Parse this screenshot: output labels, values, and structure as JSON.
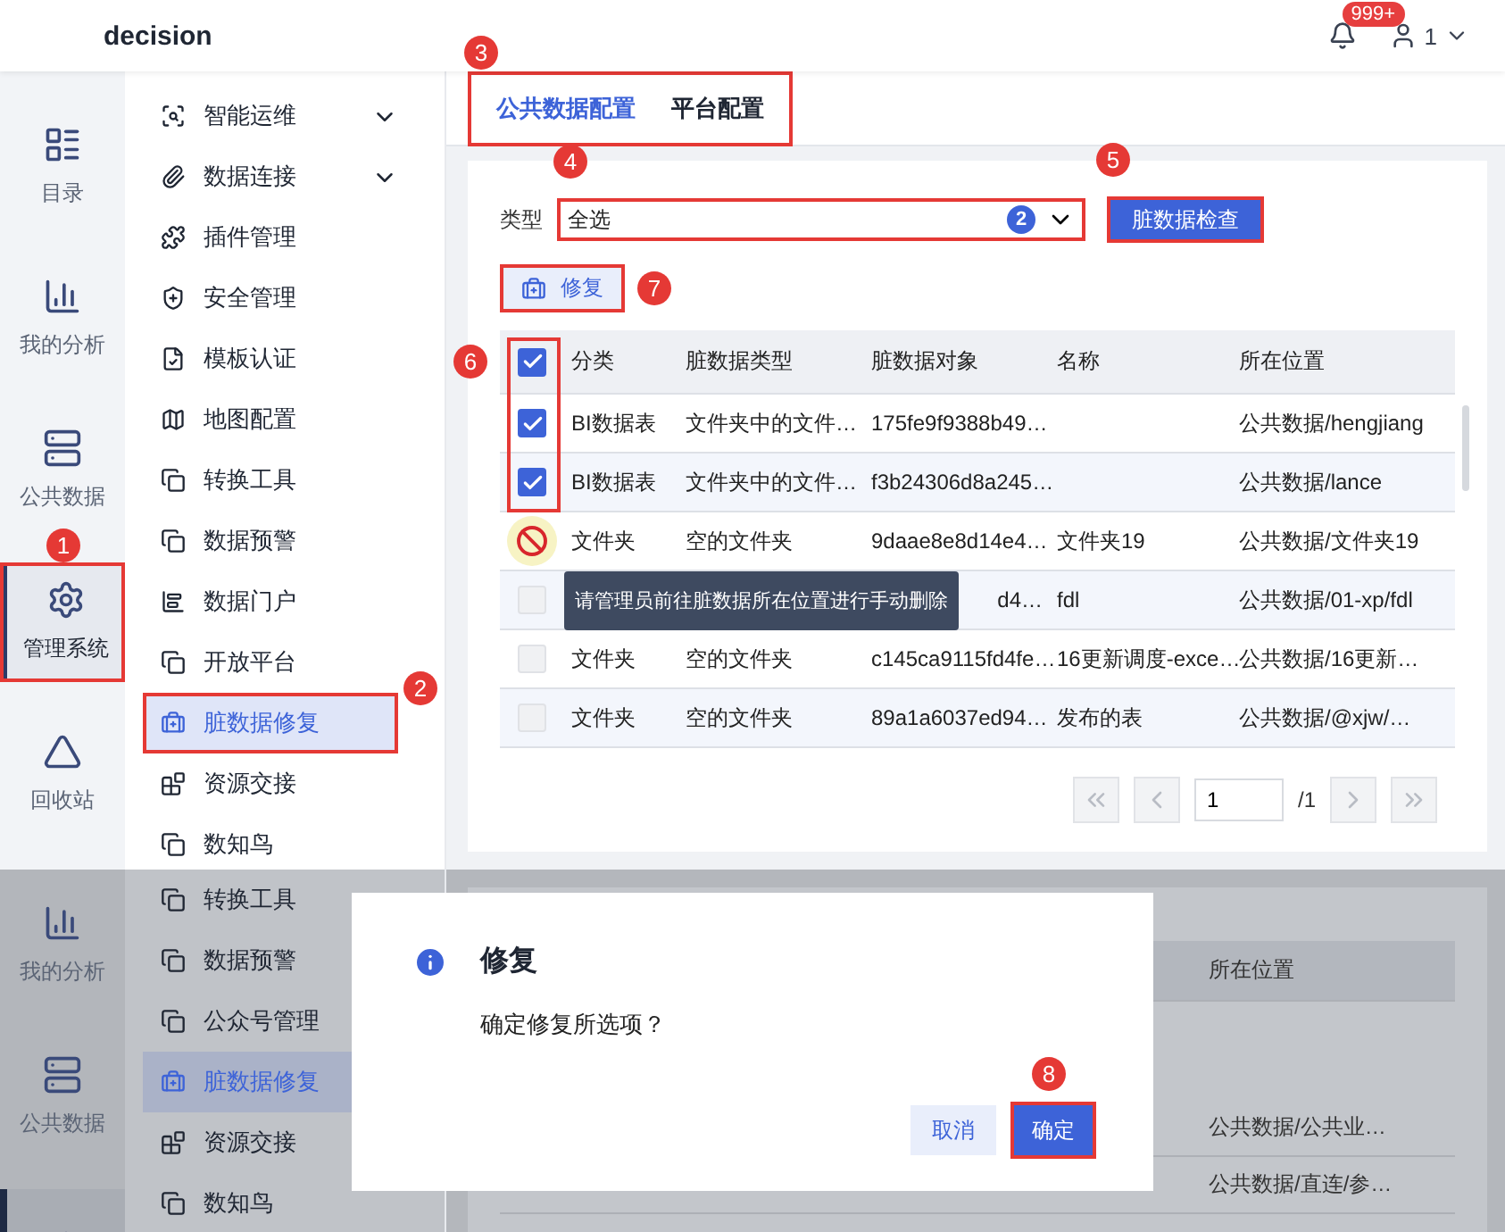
{
  "header": {
    "title": "decision",
    "notification_count": "999+",
    "user": "1"
  },
  "rail": [
    {
      "label": "目录",
      "selected": false
    },
    {
      "label": "我的分析",
      "selected": false
    },
    {
      "label": "公共数据",
      "selected": false
    },
    {
      "label": "管理系统",
      "selected": true,
      "callout": "1"
    },
    {
      "label": "回收站",
      "selected": false
    }
  ],
  "menu": [
    {
      "label": "智能运维",
      "expandable": true,
      "selected": false
    },
    {
      "label": "数据连接",
      "expandable": true,
      "selected": false
    },
    {
      "label": "插件管理",
      "expandable": false,
      "selected": false
    },
    {
      "label": "安全管理",
      "expandable": false,
      "selected": false
    },
    {
      "label": "模板认证",
      "expandable": false,
      "selected": false
    },
    {
      "label": "地图配置",
      "expandable": false,
      "selected": false
    },
    {
      "label": "转换工具",
      "expandable": false,
      "selected": false
    },
    {
      "label": "数据预警",
      "expandable": false,
      "selected": false
    },
    {
      "label": "数据门户",
      "expandable": false,
      "selected": false
    },
    {
      "label": "开放平台",
      "expandable": false,
      "selected": false
    },
    {
      "label": "脏数据修复",
      "expandable": false,
      "selected": true,
      "callout": "2"
    },
    {
      "label": "资源交接",
      "expandable": false,
      "selected": false
    },
    {
      "label": "数知鸟",
      "expandable": false,
      "selected": false
    }
  ],
  "tabs": {
    "callout": "3",
    "items": [
      {
        "label": "公共数据配置",
        "selected": true
      },
      {
        "label": "平台配置",
        "selected": false
      }
    ]
  },
  "filter": {
    "label": "类型",
    "value": "全选",
    "count": "2",
    "callout": "4"
  },
  "check_button": {
    "label": "脏数据检查",
    "callout": "5"
  },
  "repair_button": {
    "label": "修复",
    "callout": "7"
  },
  "table": {
    "checkbox_callout": "6",
    "header_checked": true,
    "columns": [
      "分类",
      "脏数据类型",
      "脏数据对象",
      "名称",
      "所在位置"
    ],
    "rows": [
      {
        "checked": true,
        "blocked": false,
        "cells": [
          "BI数据表",
          "文件夹中的文件…",
          "175fe9f9388b49…",
          "",
          "公共数据/hengjiang"
        ]
      },
      {
        "checked": true,
        "blocked": false,
        "cells": [
          "BI数据表",
          "文件夹中的文件…",
          "f3b24306d8a245…",
          "",
          "公共数据/lance"
        ]
      },
      {
        "blocked": true,
        "cells": [
          "文件夹",
          "空的文件夹",
          "9daae8e8d14e4…",
          "文件夹19",
          "公共数据/文件夹19"
        ]
      },
      {
        "checked": false,
        "blocked": false,
        "tooltip": "请管理员前往脏数据所在位置进行手动删除",
        "cells": [
          "",
          "",
          "d4…",
          "fdl",
          "公共数据/01-xp/fdl"
        ]
      },
      {
        "checked": false,
        "blocked": false,
        "cells": [
          "文件夹",
          "空的文件夹",
          "c145ca9115fd4fe…",
          "16更新调度-exce…",
          "公共数据/16更新…"
        ]
      },
      {
        "checked": false,
        "blocked": false,
        "cells": [
          "文件夹",
          "空的文件夹",
          "89a1a6037ed94…",
          "发布的表",
          "公共数据/@xjw/…"
        ]
      }
    ]
  },
  "pagination": {
    "page": "1",
    "total": "/1"
  },
  "second_view": {
    "rail": [
      {
        "label": "我的分析",
        "selected": false
      },
      {
        "label": "公共数据",
        "selected": false
      },
      {
        "selected": true
      }
    ],
    "menu": [
      {
        "label": "转换工具",
        "selected": false
      },
      {
        "label": "数据预警",
        "selected": false
      },
      {
        "label": "公众号管理",
        "selected": false
      },
      {
        "label": "脏数据修复",
        "selected": true
      },
      {
        "label": "资源交接",
        "selected": false
      },
      {
        "label": "数知鸟",
        "selected": false
      }
    ],
    "column": "所在位置",
    "rows": [
      "公共数据/公共业…",
      "公共数据/直连/参…"
    ],
    "dialog": {
      "title": "修复",
      "message": "确定修复所选项？",
      "cancel": "取消",
      "confirm": "确定",
      "callout": "8"
    }
  }
}
